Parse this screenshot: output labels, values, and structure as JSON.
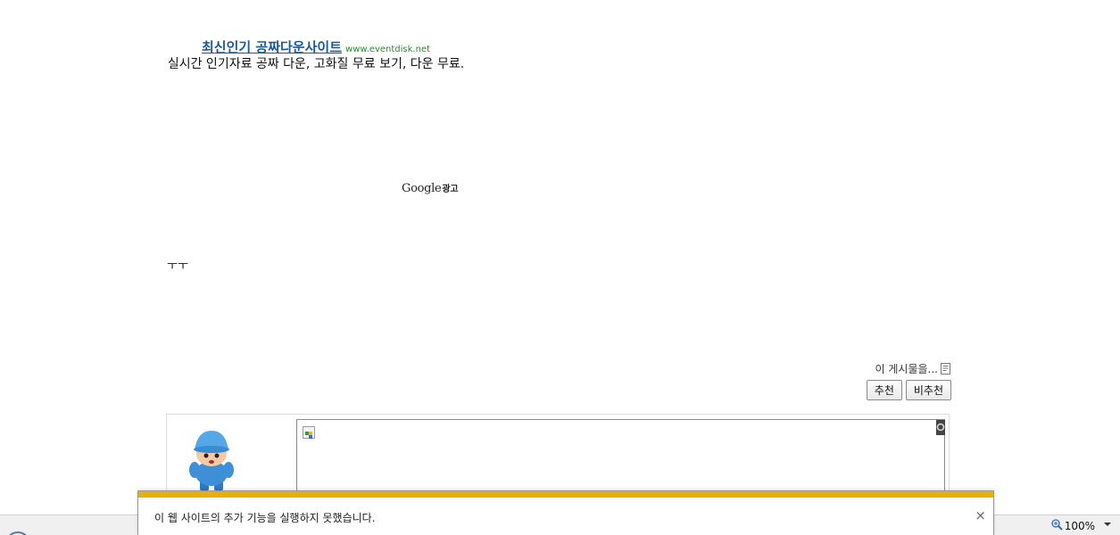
{
  "ad": {
    "title": "최신인기 공짜다운사이트",
    "url": "www.eventdisk.net",
    "description": "실시간 인기자료 공짜 다운, 고화질 무료 보기, 다운 무료."
  },
  "google_ads": {
    "brand": "Google",
    "label": "광고"
  },
  "post": {
    "text": "ㅜㅜ"
  },
  "recommend": {
    "question": "이 게시물을...",
    "recommend_label": "추천",
    "not_recommend_label": "비추천"
  },
  "statusbar": {
    "zoom": "100%"
  },
  "notification": {
    "message": "이 웹 사이트의 추가 기능을 실행하지 못했습니다.",
    "close_glyph": "×",
    "bar_color": "#e6b00b"
  },
  "icons": {
    "document": "document-icon",
    "avatar": "pocoyo-avatar",
    "broken_image": "broken-image-icon",
    "zoom": "zoom-magnifier-icon",
    "globe": "globe-icon"
  }
}
